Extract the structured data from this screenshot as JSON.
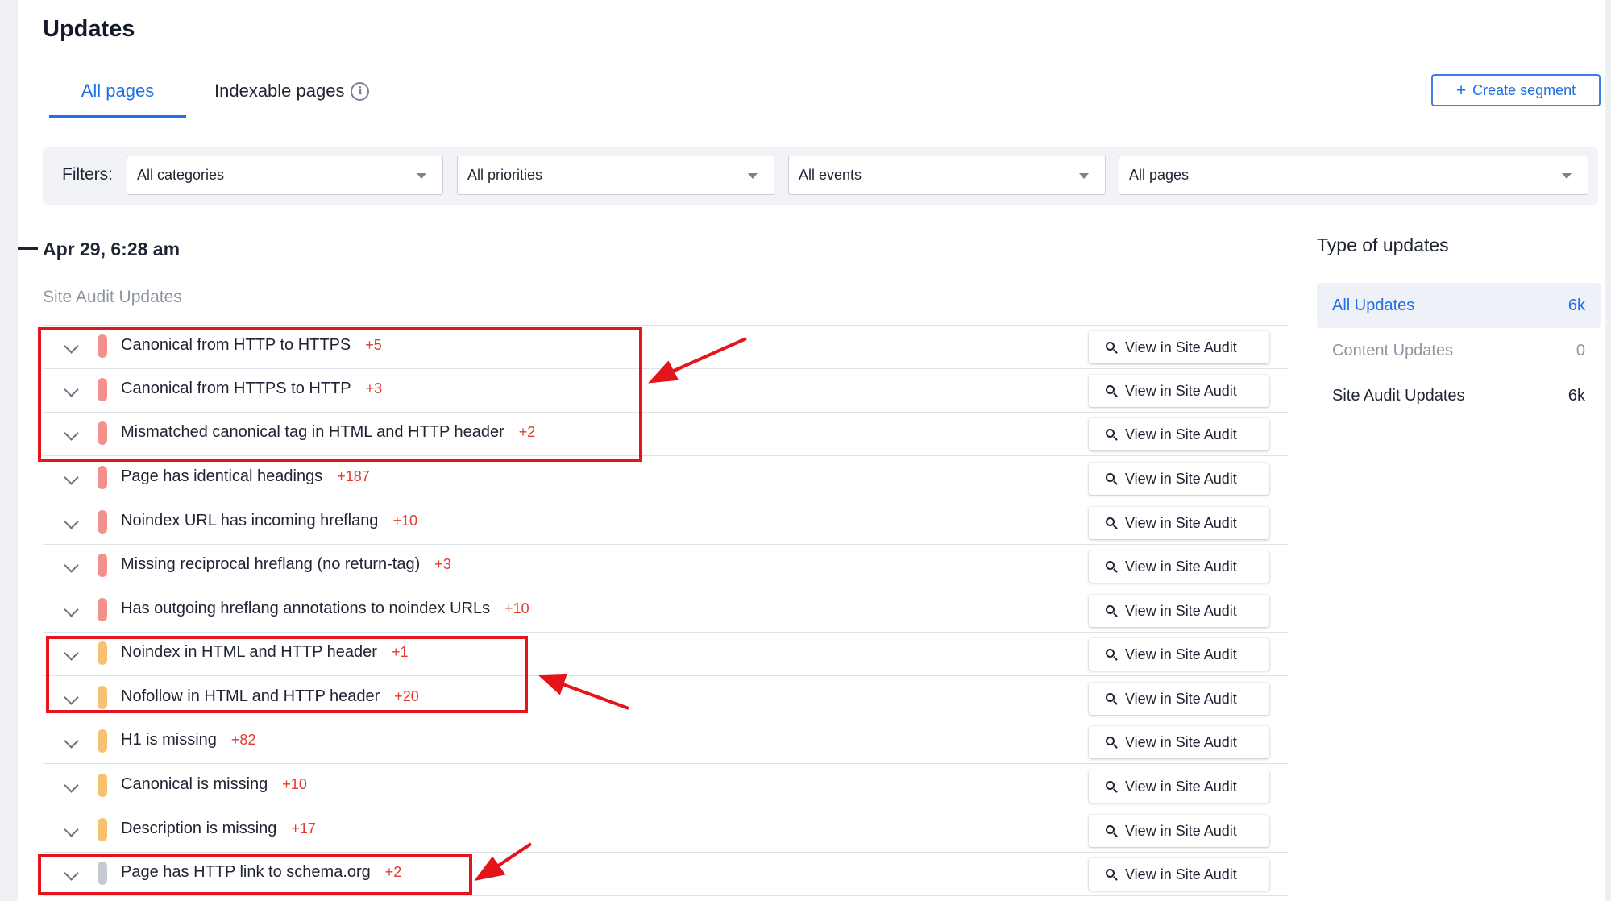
{
  "page": {
    "title": "Updates"
  },
  "tabs": [
    {
      "label": "All pages",
      "active": true
    },
    {
      "label": "Indexable pages",
      "info_icon": "info-icon"
    }
  ],
  "create_segment": {
    "icon": "plus-icon",
    "label": "Create segment"
  },
  "filters": {
    "label": "Filters:",
    "selects": [
      {
        "value": "All categories"
      },
      {
        "value": "All priorities"
      },
      {
        "value": "All events"
      },
      {
        "value": "All pages"
      }
    ]
  },
  "feed": {
    "date": "Apr 29, 6:28 am",
    "section": "Site Audit Updates",
    "view_button_label": "View in Site Audit",
    "rows": [
      {
        "name": "Canonical from HTTP to HTTPS",
        "count": "+5",
        "severity": "error"
      },
      {
        "name": "Canonical from HTTPS to HTTP",
        "count": "+3",
        "severity": "error"
      },
      {
        "name": "Mismatched canonical tag in HTML and HTTP header",
        "count": "+2",
        "severity": "error"
      },
      {
        "name": "Page has identical headings",
        "count": "+187",
        "severity": "error"
      },
      {
        "name": "Noindex URL has incoming hreflang",
        "count": "+10",
        "severity": "error"
      },
      {
        "name": "Missing reciprocal hreflang (no return-tag)",
        "count": "+3",
        "severity": "error"
      },
      {
        "name": "Has outgoing hreflang annotations to noindex URLs",
        "count": "+10",
        "severity": "error"
      },
      {
        "name": "Noindex in HTML and HTTP header",
        "count": "+1",
        "severity": "warning"
      },
      {
        "name": "Nofollow in HTML and HTTP header",
        "count": "+20",
        "severity": "warning"
      },
      {
        "name": "H1 is missing",
        "count": "+82",
        "severity": "warning"
      },
      {
        "name": "Canonical is missing",
        "count": "+10",
        "severity": "warning"
      },
      {
        "name": "Description is missing",
        "count": "+17",
        "severity": "warning"
      },
      {
        "name": "Page has HTTP link to schema.org",
        "count": "+2",
        "severity": "notice"
      }
    ]
  },
  "sidebar": {
    "title": "Type of updates",
    "items": [
      {
        "label": "All Updates",
        "count": "6k",
        "state": "active"
      },
      {
        "label": "Content Updates",
        "count": "0",
        "state": "muted"
      },
      {
        "label": "Site Audit Updates",
        "count": "6k",
        "state": "normal"
      }
    ]
  },
  "colors": {
    "accent": "#1f6fe5",
    "error": "#f4908a",
    "warning": "#f8c071",
    "notice": "#c4c9d2",
    "count": "#e23a2e",
    "annotation": "#e3141b"
  }
}
